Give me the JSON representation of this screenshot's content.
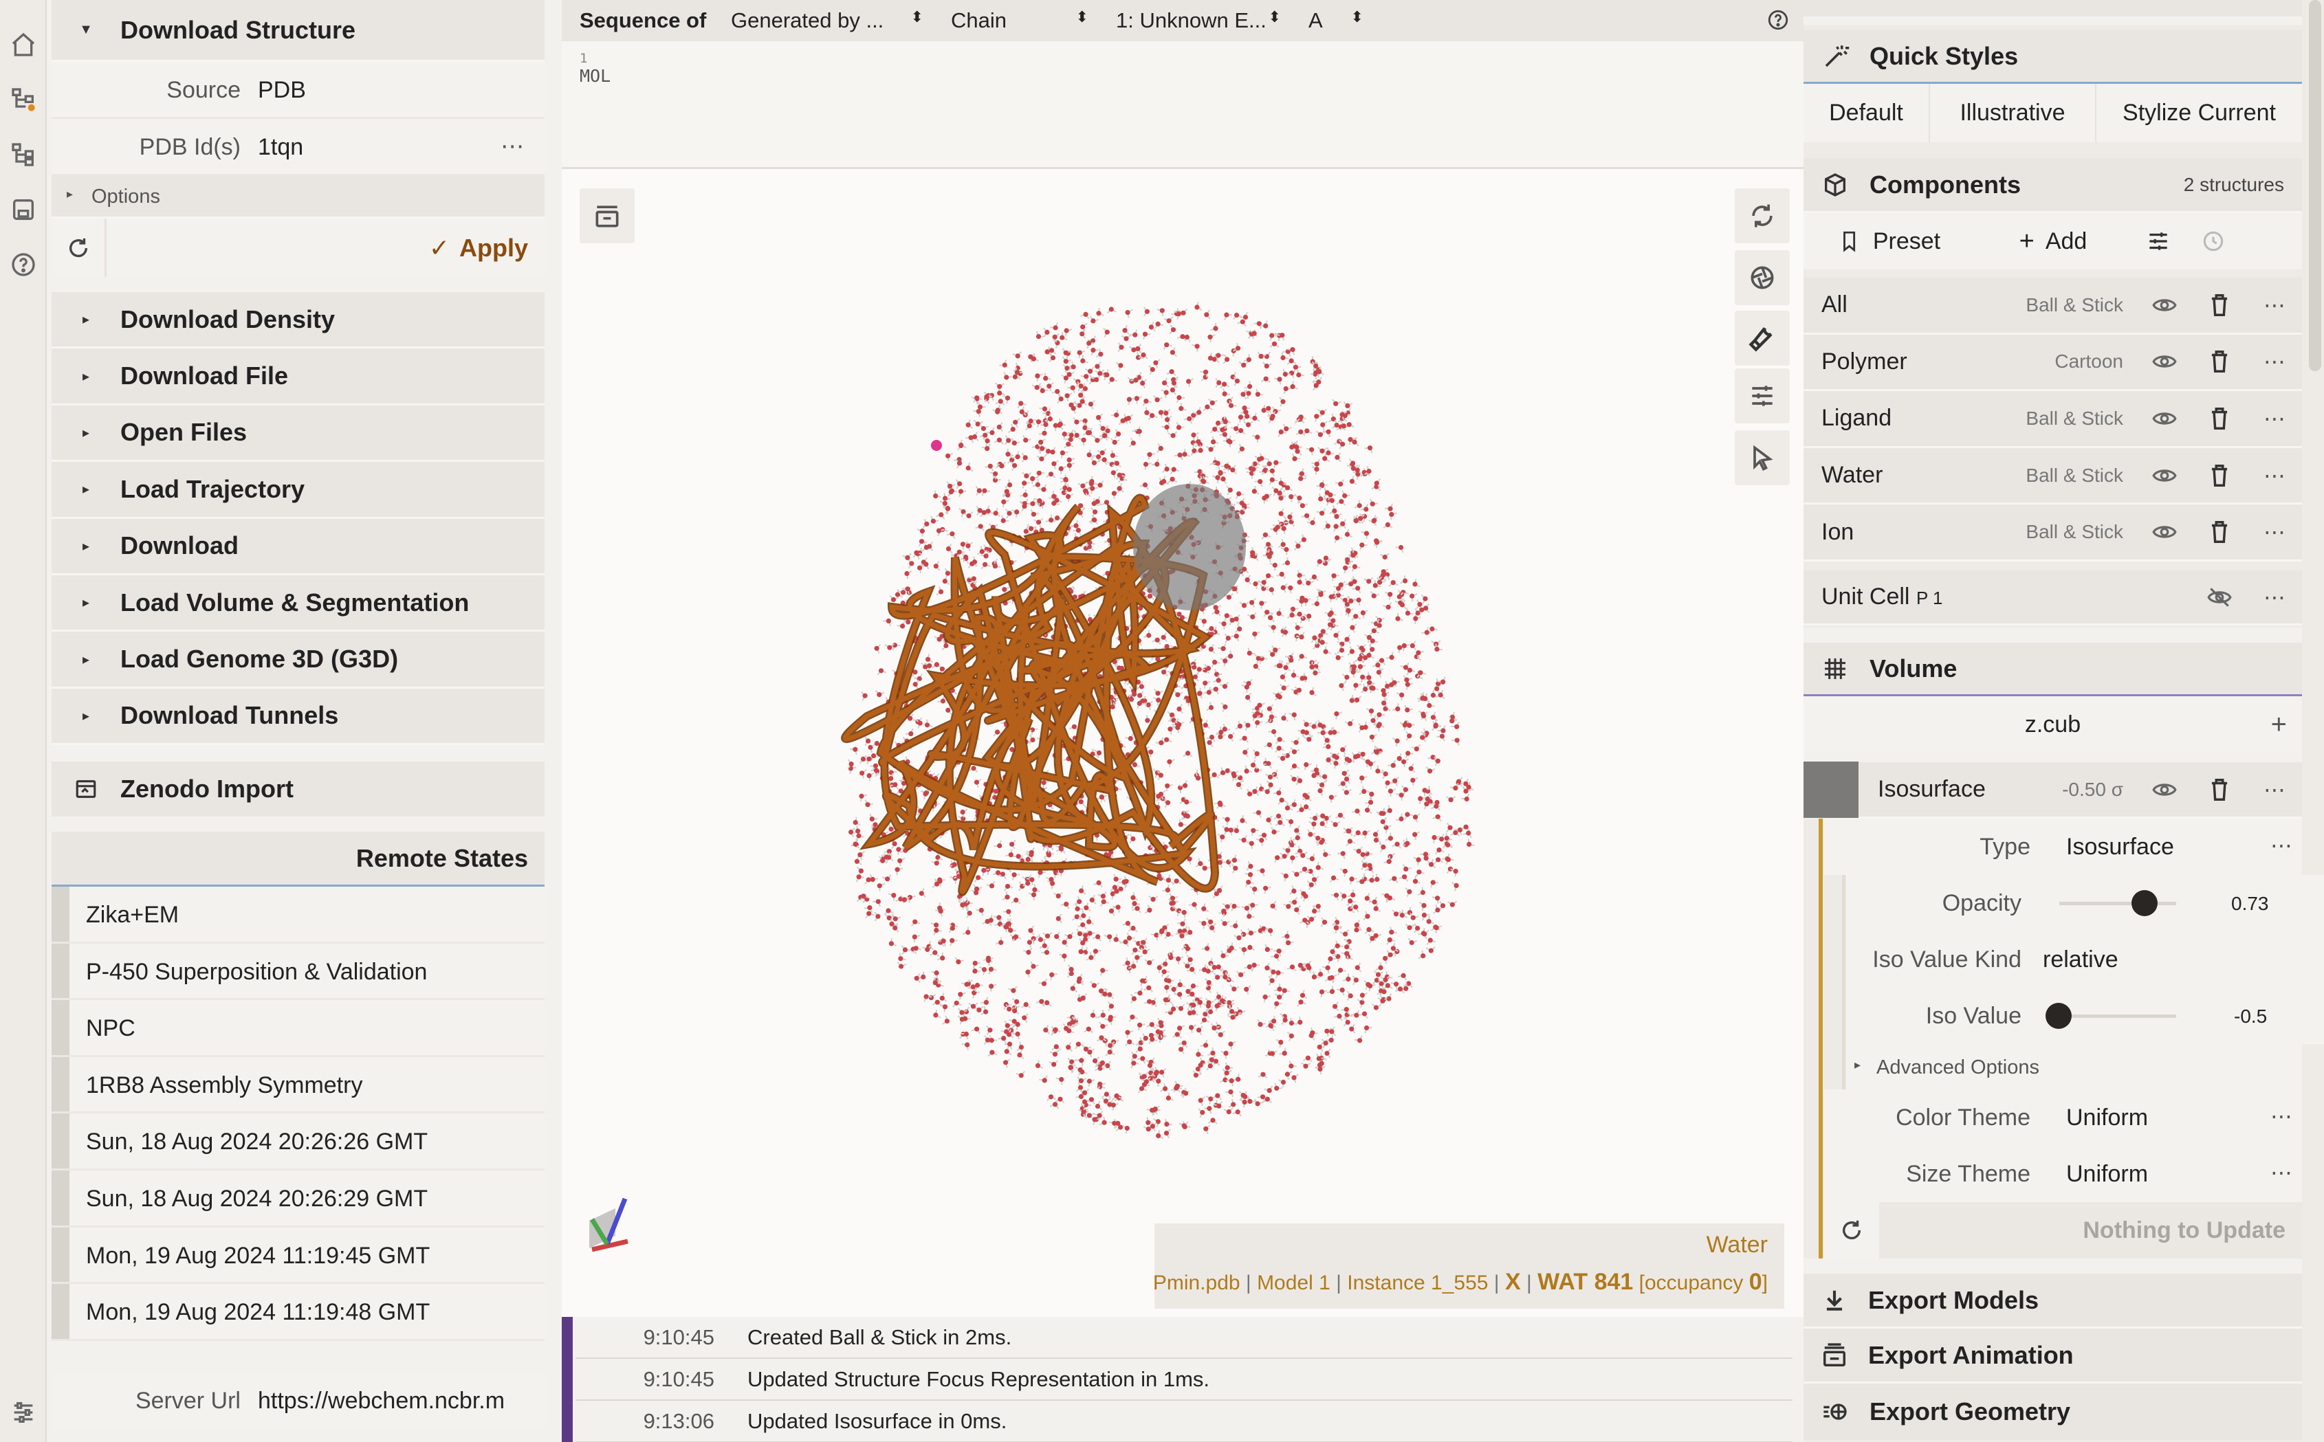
{
  "rail": {
    "icons": [
      "home-icon",
      "tree-icon",
      "tree-icon",
      "save-icon",
      "help-icon",
      "sliders-icon"
    ]
  },
  "left": {
    "download_structure": {
      "title": "Download Structure",
      "source_label": "Source",
      "source_value": "PDB",
      "ids_label": "PDB Id(s)",
      "ids_value": "1tqn",
      "options_label": "Options",
      "apply_label": "Apply"
    },
    "sections": [
      "Download Density",
      "Download File",
      "Open Files",
      "Load Trajectory",
      "Download",
      "Load Volume & Segmentation",
      "Load Genome 3D (G3D)",
      "Download Tunnels"
    ],
    "zenodo": "Zenodo Import",
    "remote_states_title": "Remote States",
    "remote_states": [
      "Zika+EM",
      "P-450 Superposition & Validation",
      "NPC",
      "1RB8 Assembly Symmetry",
      "Sun, 18 Aug 2024 20:26:26 GMT",
      "Sun, 18 Aug 2024 20:26:29 GMT",
      "Mon, 19 Aug 2024 11:19:45 GMT",
      "Mon, 19 Aug 2024 11:19:48 GMT"
    ],
    "server_url_label": "Server Url",
    "server_url_value": "https://webchem.ncbr.m"
  },
  "sequence": {
    "label": "Sequence of",
    "generated": "Generated by ...",
    "mode": "Chain",
    "entity": "1: Unknown E...",
    "chain": "A",
    "index": "1",
    "residue": "MOL"
  },
  "viewport": {
    "hover_title": "Water",
    "hover_file": "Pmin.pdb",
    "hover_model": "Model 1",
    "hover_instance": "Instance 1_555",
    "hover_chain": "X",
    "hover_residue": "WAT 841",
    "hover_occ_pre": "[occupancy ",
    "hover_occ_val": "0",
    "hover_occ_post": "]"
  },
  "log": [
    {
      "time": "9:10:45",
      "msg": "Created Ball & Stick in 2ms."
    },
    {
      "time": "9:10:45",
      "msg": "Updated Structure Focus Representation in 1ms."
    },
    {
      "time": "9:13:06",
      "msg": "Updated Isosurface in 0ms."
    }
  ],
  "right": {
    "quick_styles": "Quick Styles",
    "styles": [
      "Default",
      "Illustrative",
      "Stylize Current"
    ],
    "components_title": "Components",
    "components_count": "2 structures",
    "preset_label": "Preset",
    "add_label": "Add",
    "components": [
      {
        "name": "All",
        "kind": "Ball & Stick"
      },
      {
        "name": "Polymer",
        "kind": "Cartoon"
      },
      {
        "name": "Ligand",
        "kind": "Ball & Stick"
      },
      {
        "name": "Water",
        "kind": "Ball & Stick"
      },
      {
        "name": "Ion",
        "kind": "Ball & Stick"
      }
    ],
    "unit_cell": "Unit Cell",
    "unit_cell_sub": "P 1",
    "volume_title": "Volume",
    "volume_file": "z.cub",
    "iso_name": "Isosurface",
    "iso_value_badge": "-0.50 σ",
    "type_label": "Type",
    "type_value": "Isosurface",
    "opacity_label": "Opacity",
    "opacity_value": "0.73",
    "iso_kind_label": "Iso Value Kind",
    "iso_kind_value": "relative",
    "iso_value_label": "Iso Value",
    "iso_value_value": "-0.5",
    "advanced_label": "Advanced Options",
    "color_theme_label": "Color Theme",
    "color_theme_value": "Uniform",
    "size_theme_label": "Size Theme",
    "size_theme_value": "Uniform",
    "nothing_label": "Nothing to Update",
    "export_models": "Export Models",
    "export_animation": "Export Animation",
    "export_geometry": "Export Geometry"
  },
  "colors": {
    "accent": "#8a4b0d",
    "volume_line": "#c79a2e",
    "log_bar": "#5a3a85",
    "water_red": "#c8454a",
    "ribbon": "#b5601a"
  }
}
